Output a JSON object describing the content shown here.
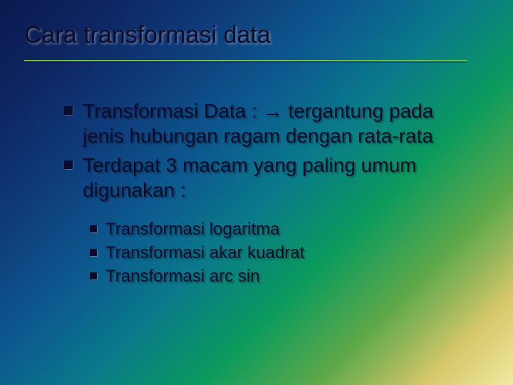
{
  "slide": {
    "title": "Cara transformasi data",
    "bullets": [
      "Transformasi Data : → tergantung pada jenis hubungan ragam dengan rata-rata",
      "Terdapat 3 macam yang paling umum digunakan :"
    ],
    "subbullets": [
      "Transformasi logaritma",
      "Transformasi akar kuadrat",
      "Transformasi arc sin"
    ]
  }
}
